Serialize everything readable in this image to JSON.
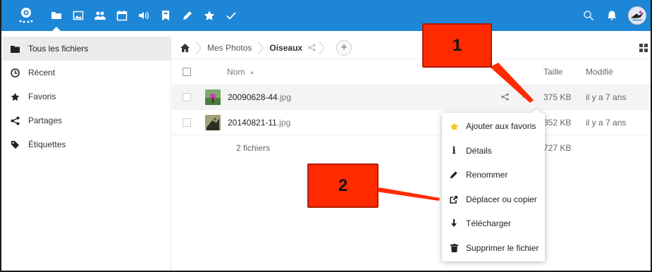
{
  "colors": {
    "header": "#1d86d6",
    "callout": "#ff2a00",
    "star": "#f5c518"
  },
  "header": {
    "apps": [
      "files-icon",
      "gallery-icon",
      "contacts-icon",
      "calendar-icon",
      "audio-icon",
      "deck-icon",
      "notes-icon",
      "favorites-app-icon",
      "tasks-icon"
    ],
    "right_icons": [
      "search-icon",
      "notifications-icon",
      "user-avatar"
    ]
  },
  "sidebar": {
    "items": [
      {
        "label": "Tous les fichiers",
        "icon": "folder-icon"
      },
      {
        "label": "Récent",
        "icon": "clock-icon"
      },
      {
        "label": "Favoris",
        "icon": "star-icon"
      },
      {
        "label": "Partages",
        "icon": "share-icon"
      },
      {
        "label": "Étiquettes",
        "icon": "tag-icon"
      }
    ]
  },
  "breadcrumb": {
    "items": [
      "Mes Photos",
      "Oiseaux"
    ]
  },
  "table": {
    "headers": {
      "name": "Nom",
      "size": "Taille",
      "modified": "Modifié"
    },
    "rows": [
      {
        "name": "20090628-44",
        "ext": ".jpg",
        "size": "375 KB",
        "modified": "il y a 7 ans"
      },
      {
        "name": "20140821-11",
        "ext": ".jpg",
        "size": "352 KB",
        "modified": "il y a 7 ans"
      }
    ],
    "summary": {
      "count": "2 fichiers",
      "size": "727 KB"
    },
    "more_actions": "···"
  },
  "menu": {
    "items": [
      {
        "label": "Ajouter aux favoris",
        "icon": "star-icon"
      },
      {
        "label": "Détails",
        "icon": "info-icon"
      },
      {
        "label": "Renommer",
        "icon": "pencil-icon"
      },
      {
        "label": "Déplacer ou copier",
        "icon": "external-icon"
      },
      {
        "label": "Télécharger",
        "icon": "download-icon"
      },
      {
        "label": "Supprimer le fichier",
        "icon": "trash-icon"
      }
    ]
  },
  "callouts": [
    "1",
    "2"
  ]
}
